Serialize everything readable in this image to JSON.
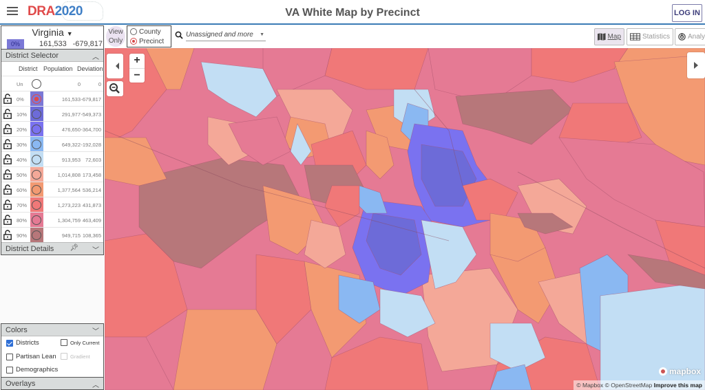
{
  "header": {
    "logo_dra": "DRA",
    "logo_year": "2020",
    "title": "VA White Map by Precinct",
    "login_label": "LOG IN"
  },
  "state": {
    "name": "Virginia",
    "pct": "0%",
    "population": "161,533",
    "deviation": "-679,817"
  },
  "district_selector": {
    "title": "District Selector",
    "columns": [
      "District",
      "Population",
      "Deviation"
    ],
    "rows": [
      {
        "label": "Un",
        "population": "0",
        "deviation": "0",
        "color": "",
        "locked": false,
        "selected": false
      },
      {
        "label": "0%",
        "population": "161,533",
        "deviation": "-679,817",
        "color": "#7b78d6",
        "locked": true,
        "selected": true
      },
      {
        "label": "10%",
        "population": "291,977",
        "deviation": "-549,373",
        "color": "#6d6bd8",
        "locked": true,
        "selected": false
      },
      {
        "label": "20%",
        "population": "476,650",
        "deviation": "-364,700",
        "color": "#7a72f0",
        "locked": true,
        "selected": false
      },
      {
        "label": "30%",
        "population": "649,322",
        "deviation": "-192,028",
        "color": "#8ab8f2",
        "locked": true,
        "selected": false
      },
      {
        "label": "40%",
        "population": "913,953",
        "deviation": "72,603",
        "color": "#c2def4",
        "locked": true,
        "selected": false
      },
      {
        "label": "50%",
        "population": "1,014,808",
        "deviation": "173,458",
        "color": "#f4a898",
        "locked": true,
        "selected": false
      },
      {
        "label": "60%",
        "population": "1,377,564",
        "deviation": "536,214",
        "color": "#f39a72",
        "locked": true,
        "selected": false
      },
      {
        "label": "70%",
        "population": "1,273,223",
        "deviation": "431,873",
        "color": "#f07878",
        "locked": true,
        "selected": false
      },
      {
        "label": "80%",
        "population": "1,304,759",
        "deviation": "463,409",
        "color": "#e57a94",
        "locked": true,
        "selected": false
      },
      {
        "label": "90%",
        "population": "949,715",
        "deviation": "108,365",
        "color": "#b7777a",
        "locked": true,
        "selected": false
      }
    ]
  },
  "district_details": {
    "title": "District Details"
  },
  "colors_panel": {
    "title": "Colors",
    "options": {
      "districts": {
        "label": "Districts",
        "checked": true
      },
      "only_current": {
        "label": "Only Current",
        "checked": false
      },
      "partisan_lean": {
        "label": "Partisan Lean",
        "checked": false
      },
      "gradient": {
        "label": "Gradient",
        "checked": false,
        "disabled": true
      },
      "demographics": {
        "label": "Demographics",
        "checked": false
      }
    }
  },
  "overlays": {
    "title": "Overlays"
  },
  "toolbar": {
    "view_only_line1": "View",
    "view_only_line2": "Only",
    "layer_options": [
      "County",
      "Precinct"
    ],
    "layer_selected": "Precinct",
    "search_placeholder": "Unassigned and more",
    "views": [
      {
        "label": "Map",
        "icon": "map-icon",
        "active": true
      },
      {
        "label": "Statistics",
        "icon": "table-icon",
        "active": false
      },
      {
        "label": "Analy",
        "icon": "analytics-icon",
        "active": false
      }
    ]
  },
  "map": {
    "zoom_in": "+",
    "zoom_out": "−",
    "mapbox_logo": "mapbox",
    "attribution_1": "© Mapbox © OpenStreetMap",
    "attribution_2": "Improve this map",
    "palette": {
      "d0": "#7b78d6",
      "d10": "#6d6bd8",
      "d20": "#7a72f0",
      "d30": "#8ab8f2",
      "d40": "#c2def4",
      "d50": "#f4a898",
      "d60": "#f39a72",
      "d70": "#f07878",
      "d80": "#e57a94",
      "d90": "#b7777a"
    }
  }
}
